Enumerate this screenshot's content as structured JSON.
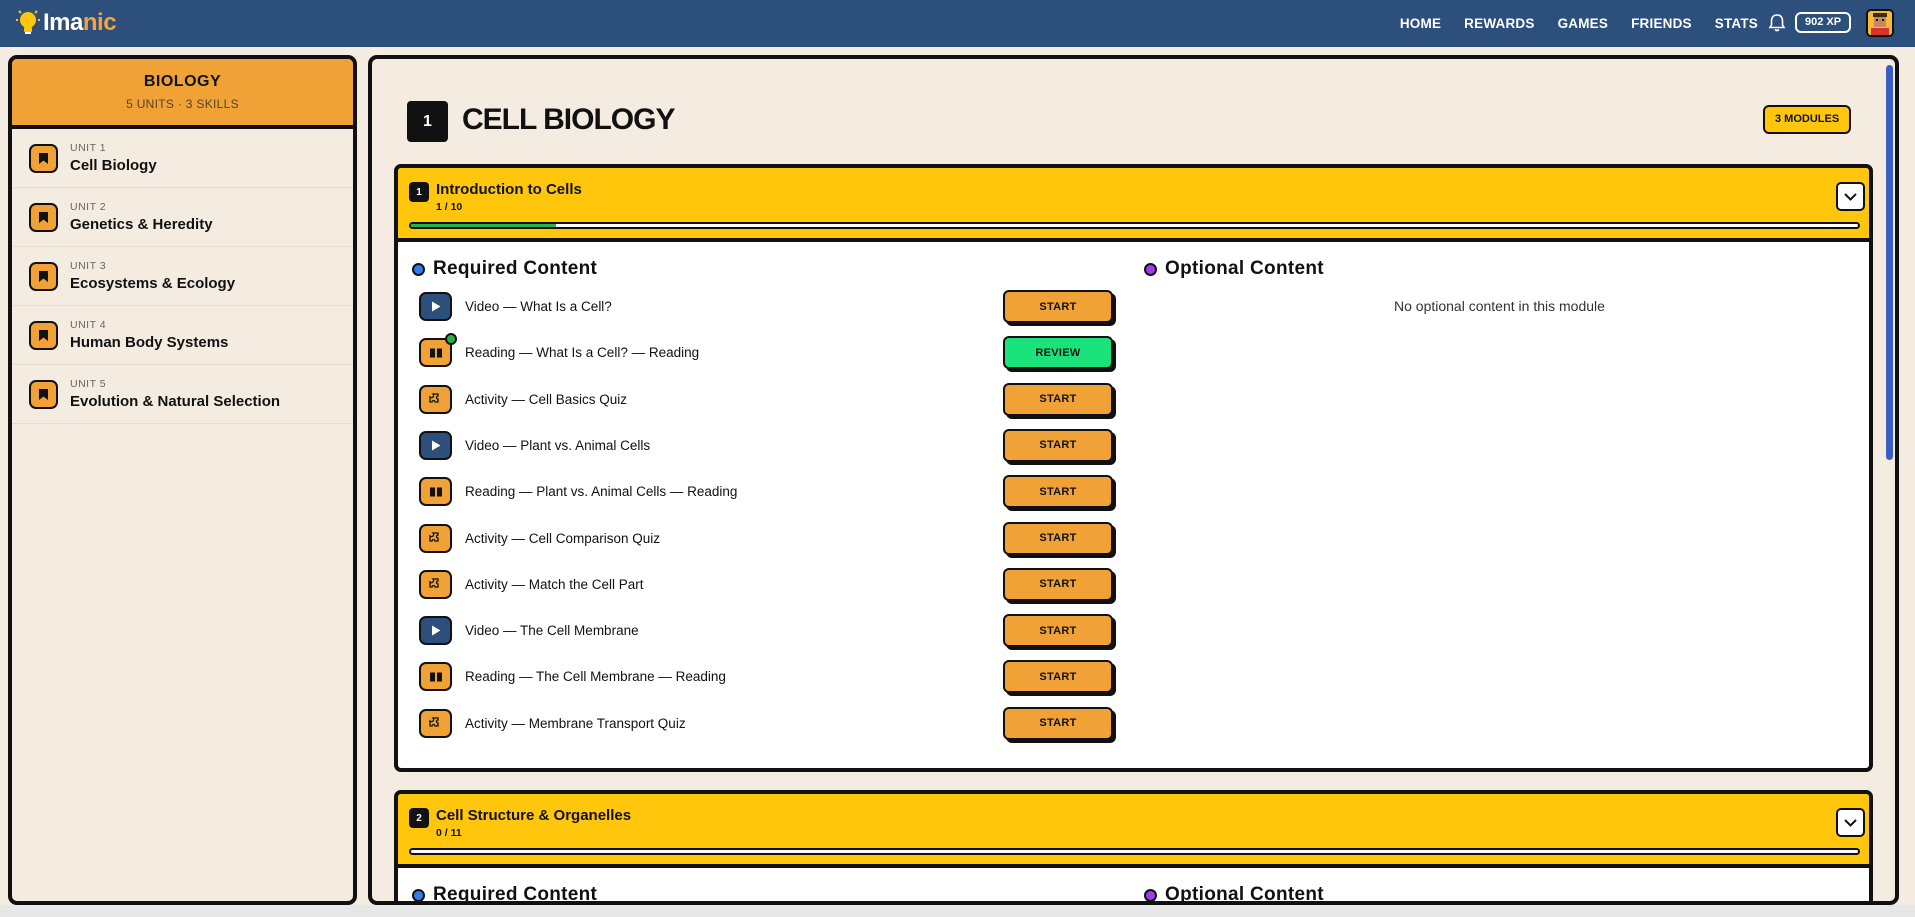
{
  "app": {
    "logo_main": "Ima",
    "logo_accent": "nic",
    "nav": [
      "HOME",
      "REWARDS",
      "GAMES",
      "FRIENDS",
      "STATS"
    ],
    "xp": "902 XP"
  },
  "sidebar": {
    "title": "BIOLOGY",
    "subtitle": "5 UNITS · 3 SKILLS",
    "units": [
      {
        "unit": "UNIT 1",
        "name": "Cell Biology"
      },
      {
        "unit": "UNIT 2",
        "name": "Genetics & Heredity"
      },
      {
        "unit": "UNIT 3",
        "name": "Ecosystems & Ecology"
      },
      {
        "unit": "UNIT 4",
        "name": "Human Body Systems"
      },
      {
        "unit": "UNIT 5",
        "name": "Evolution & Natural Selection"
      }
    ]
  },
  "main": {
    "unit_number": "1",
    "unit_title": "CELL BIOLOGY",
    "modules_pill": "3 MODULES",
    "required_heading": "Required Content",
    "optional_heading": "Optional Content",
    "no_optional": "No optional content in this module",
    "modules": [
      {
        "number": "1",
        "title": "Introduction to Cells",
        "count": "1 / 10",
        "progress": 0.1,
        "items": [
          {
            "type": "video",
            "label": "Video — What Is a Cell?",
            "button": "START",
            "done": false
          },
          {
            "type": "reading",
            "label": "Reading — What Is a Cell? — Reading",
            "button": "REVIEW",
            "done": true
          },
          {
            "type": "activity",
            "label": "Activity — Cell Basics Quiz",
            "button": "START",
            "done": false
          },
          {
            "type": "video",
            "label": "Video — Plant vs. Animal Cells",
            "button": "START",
            "done": false
          },
          {
            "type": "reading",
            "label": "Reading — Plant vs. Animal Cells — Reading",
            "button": "START",
            "done": false
          },
          {
            "type": "activity",
            "label": "Activity — Cell Comparison Quiz",
            "button": "START",
            "done": false
          },
          {
            "type": "activity",
            "label": "Activity — Match the Cell Part",
            "button": "START",
            "done": false
          },
          {
            "type": "video",
            "label": "Video — The Cell Membrane",
            "button": "START",
            "done": false
          },
          {
            "type": "reading",
            "label": "Reading — The Cell Membrane — Reading",
            "button": "START",
            "done": false
          },
          {
            "type": "activity",
            "label": "Activity — Membrane Transport Quiz",
            "button": "START",
            "done": false
          }
        ]
      },
      {
        "number": "2",
        "title": "Cell Structure & Organelles",
        "count": "0 / 11",
        "progress": 0
      }
    ]
  },
  "colors": {
    "topbar": "#2d4f7c",
    "accent_orange": "#f0a236",
    "module_yellow": "#ffc60b",
    "review_green": "#19e37a",
    "progress_green": "#27b24a"
  }
}
